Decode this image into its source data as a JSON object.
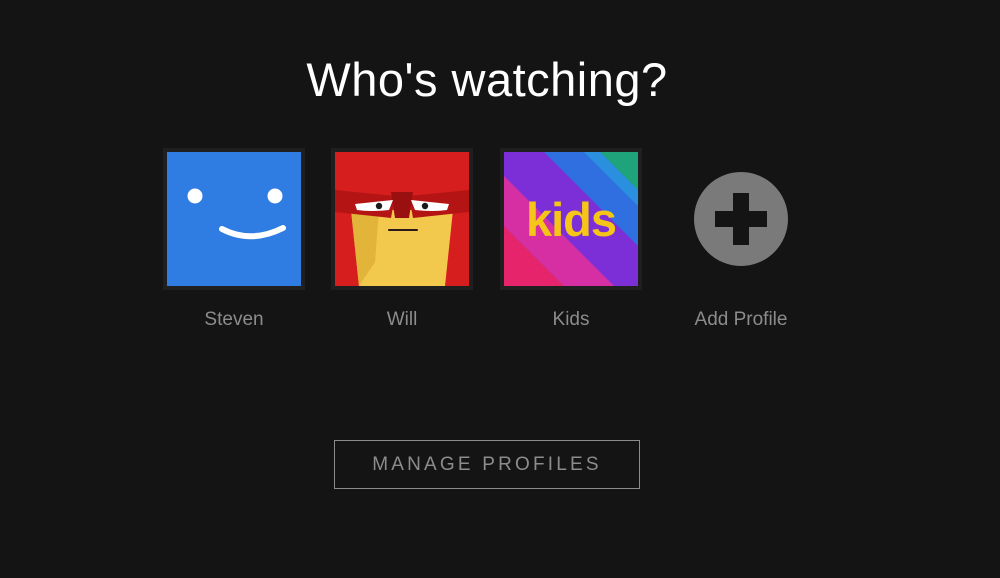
{
  "page_title": "Who's watching?",
  "profiles": [
    {
      "name": "Steven",
      "avatar_icon": "smile-face-icon",
      "color": "#2f7ce3"
    },
    {
      "name": "Will",
      "avatar_icon": "angry-face-icon",
      "color": "#d61e1e"
    },
    {
      "name": "Kids",
      "avatar_icon": "kids-logo-icon",
      "avatar_text": "kids",
      "color": "#f5c518"
    }
  ],
  "add_profile": {
    "label": "Add Profile",
    "icon": "plus-circle-icon"
  },
  "manage_button": {
    "label": "MANAGE PROFILES"
  },
  "colors": {
    "background": "#141414",
    "title": "#ffffff",
    "muted_text": "#8c8c8c"
  }
}
